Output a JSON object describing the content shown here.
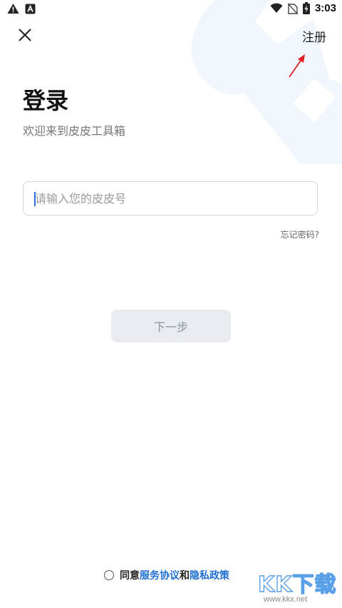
{
  "status_bar": {
    "time": "3:03",
    "left_icons": [
      "warning-icon",
      "app-notification-icon"
    ],
    "right_icons": [
      "wifi-icon",
      "no-sim-icon",
      "battery-charging-icon"
    ]
  },
  "header": {
    "close_icon": "close-icon",
    "register_label": "注册"
  },
  "login": {
    "title": "登录",
    "subtitle": "欢迎来到皮皮工具箱",
    "account_input": {
      "value": "",
      "placeholder": "请输入您的皮皮号"
    },
    "forgot_label": "忘记密码?",
    "next_label": "下一步"
  },
  "agreement": {
    "prefix": "同意",
    "service_label": "服务协议",
    "joiner": "和",
    "privacy_label": "隐私政策"
  },
  "watermark": {
    "url": "www.kkx.net"
  },
  "colors": {
    "accent": "#1f6fd1",
    "button_disabled_bg": "#e8ebef",
    "button_disabled_text": "#8e949c",
    "annotation_arrow": "#e02020"
  }
}
